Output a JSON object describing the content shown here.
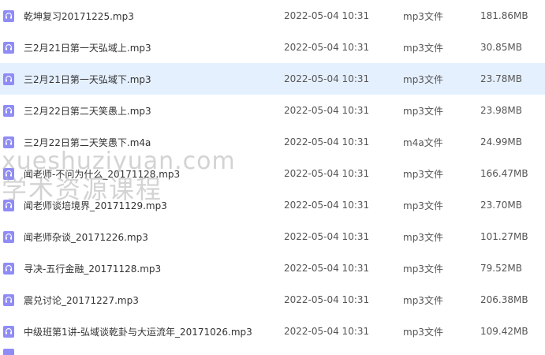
{
  "colors": {
    "icon_purple": "#8f8cf5",
    "selected_row_bg": "#e5f0ff",
    "watermark_gray": "#afafaf"
  },
  "file_icon": "headphones-icon",
  "files": [
    {
      "name": "乾坤复习20171225.mp3",
      "date": "2022-05-04 10:31",
      "type": "mp3文件",
      "size": "181.86MB"
    },
    {
      "name": "三2月21日第一天弘域上.mp3",
      "date": "2022-05-04 10:31",
      "type": "mp3文件",
      "size": "30.85MB"
    },
    {
      "name": "三2月21日第一天弘域下.mp3",
      "date": "2022-05-04 10:31",
      "type": "mp3文件",
      "size": "23.78MB"
    },
    {
      "name": "三2月22日第二天笑愚上.mp3",
      "date": "2022-05-04 10:31",
      "type": "mp3文件",
      "size": "23.98MB"
    },
    {
      "name": "三2月22日第二天笑愚下.m4a",
      "date": "2022-05-04 10:31",
      "type": "m4a文件",
      "size": "24.99MB"
    },
    {
      "name": "闻老师-不问为什么_20171128.mp3",
      "date": "2022-05-04 10:31",
      "type": "mp3文件",
      "size": "166.47MB"
    },
    {
      "name": "闻老师谈培境界_20171129.mp3",
      "date": "2022-05-04 10:31",
      "type": "mp3文件",
      "size": "23.70MB"
    },
    {
      "name": "闻老师杂谈_20171226.mp3",
      "date": "2022-05-04 10:31",
      "type": "mp3文件",
      "size": "101.27MB"
    },
    {
      "name": "寻决-五行金融_20171128.mp3",
      "date": "2022-05-04 10:31",
      "type": "mp3文件",
      "size": "79.52MB"
    },
    {
      "name": "震兑讨论_20171227.mp3",
      "date": "2022-05-04 10:31",
      "type": "mp3文件",
      "size": "206.38MB"
    },
    {
      "name": "中级班第1讲-弘域谈乾卦与大运流年_20171026.mp3",
      "date": "2022-05-04 10:31",
      "type": "mp3文件",
      "size": "109.42MB"
    }
  ],
  "selected_index": 2,
  "watermark": {
    "line1": "xueshuziyuan.com",
    "line2": "学术资源课程"
  }
}
